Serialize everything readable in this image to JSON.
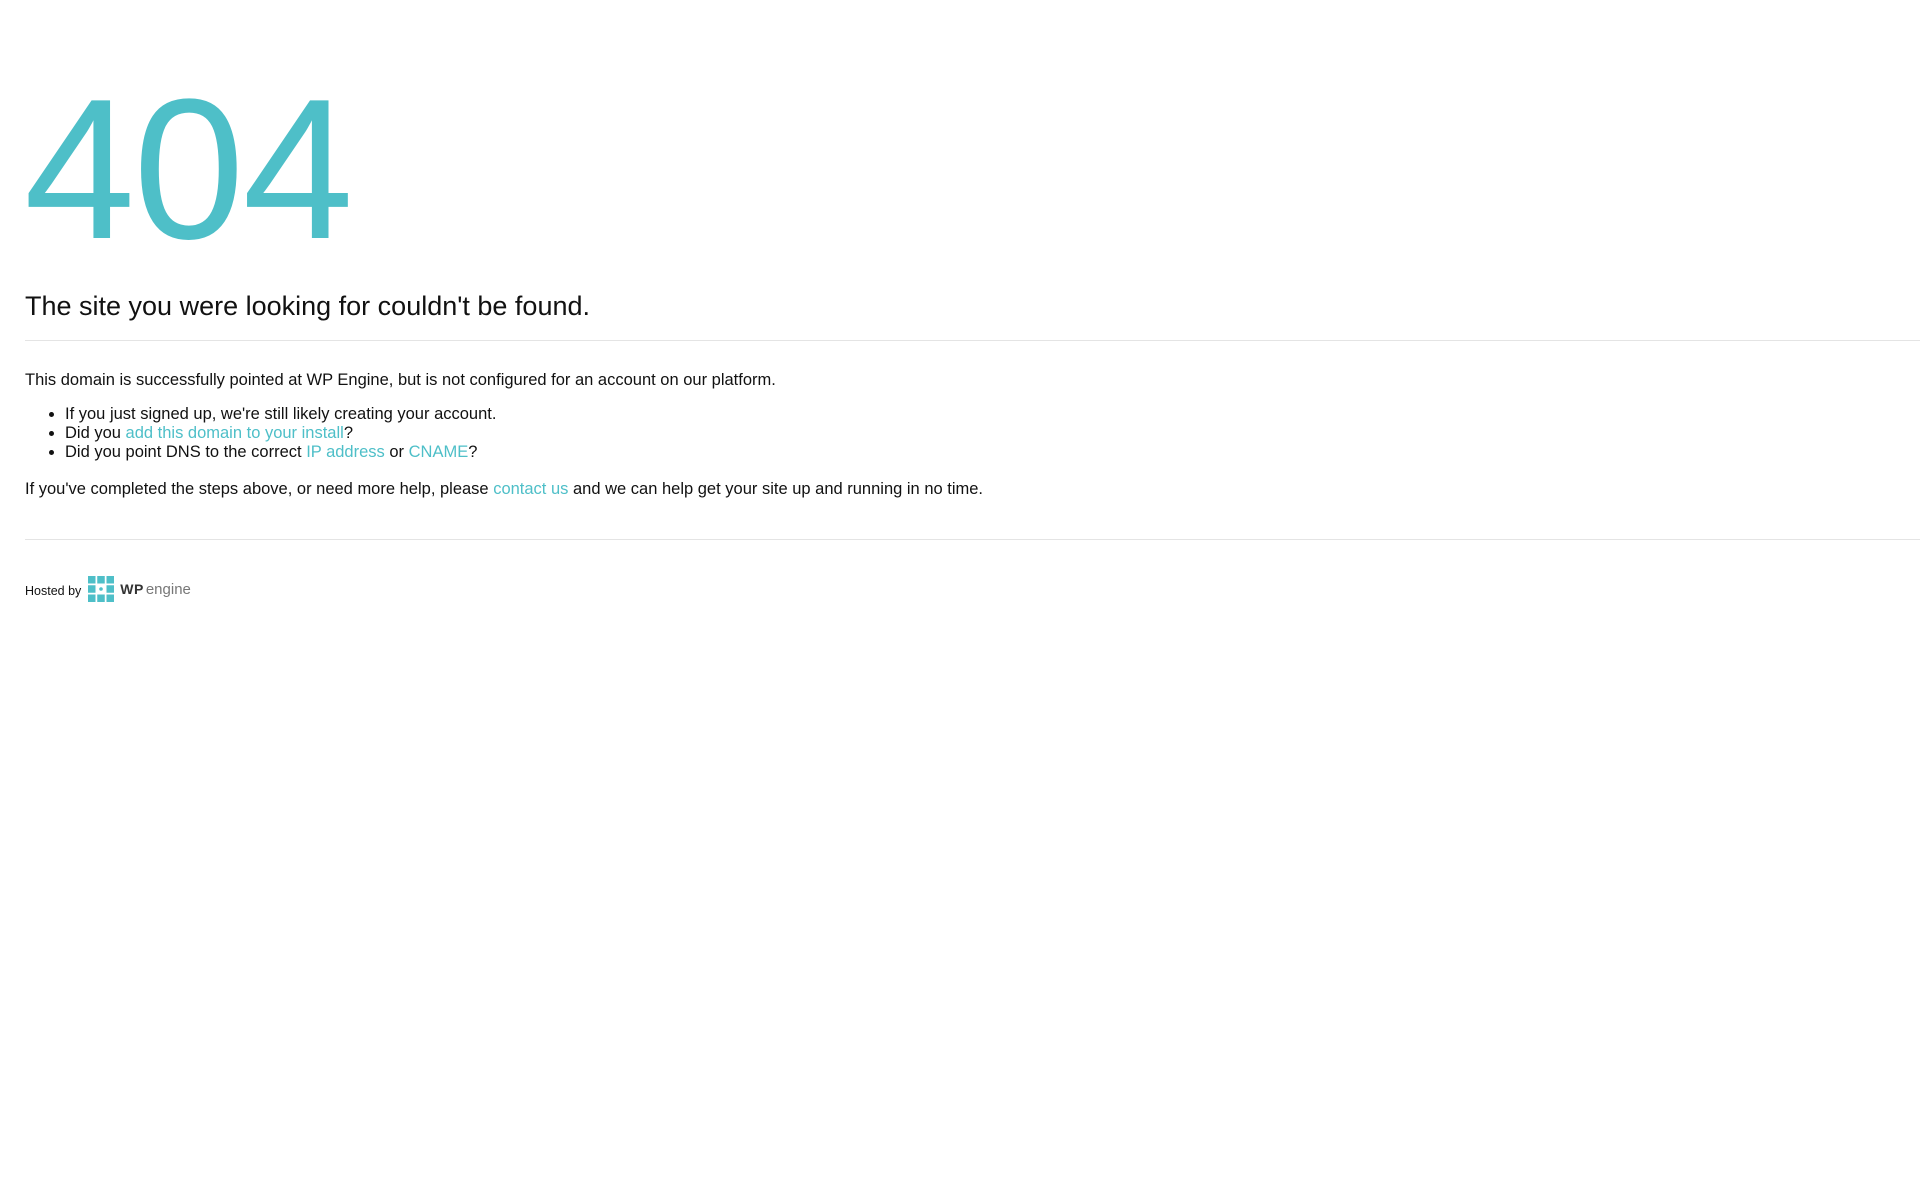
{
  "error": {
    "code": "404",
    "headline": "The site you were looking for couldn't be found."
  },
  "message": {
    "intro": "This domain is successfully pointed at WP Engine, but is not configured for an account on our platform.",
    "bullets": {
      "b1": "If you just signed up, we're still likely creating your account.",
      "b2_prefix": "Did you ",
      "b2_link": "add this domain to your install",
      "b2_suffix": "?",
      "b3_prefix": "Did you point DNS to the correct ",
      "b3_link1": "IP address",
      "b3_mid": " or ",
      "b3_link2": "CNAME",
      "b3_suffix": "?"
    },
    "help_prefix": "If you've completed the steps above, or need more help, please ",
    "help_link": "contact us",
    "help_suffix": " and we can help get your site up and running in no time."
  },
  "footer": {
    "hosted_label": "Hosted by",
    "logo_wp": "WP",
    "logo_engine": "engine",
    "logo_icon": "wpengine-grid-logo-icon"
  },
  "colors": {
    "accent": "#4ebfc8",
    "text": "#111111",
    "rule": "#e4e4e4",
    "background": "#ffffff"
  }
}
